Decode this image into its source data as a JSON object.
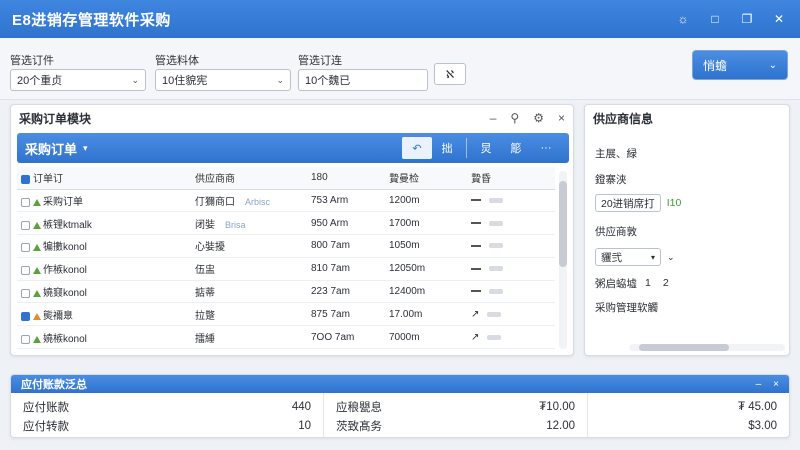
{
  "window": {
    "title": "E8进销存管理软件采购"
  },
  "filters": {
    "order": {
      "label": "管选订件",
      "value": "20个重贞"
    },
    "material": {
      "label": "管选料体",
      "value": "10住貌宪"
    },
    "orderno": {
      "label": "管选订连",
      "value": "10个魏已"
    },
    "clear_label": "ℵ",
    "top_dropdown": "悄蟾"
  },
  "orders_panel": {
    "title": "采购订单模块",
    "band_title": "采购订单",
    "band_icons": [
      "↶",
      "拙",
      "炅",
      "簓",
      "···"
    ],
    "columns": [
      "订单订",
      "供应商商",
      "180",
      "贄曼检",
      "贄昏"
    ],
    "rows": [
      {
        "name": "采购订单",
        "supplier": "仃獮商口",
        "supplier_extra": "Arbisc",
        "qty": "753 Arm",
        "amount": "1200m",
        "status": "dash",
        "checked": false,
        "icon": "green"
      },
      {
        "name": "槉锂ktmalk",
        "supplier": "闭娤",
        "supplier_extra": "Brisa",
        "qty": "950 Arm",
        "amount": "1700m",
        "status": "dash",
        "checked": false,
        "icon": "green"
      },
      {
        "name": "犏擻konol",
        "supplier": "心娤擾",
        "supplier_extra": "",
        "qty": "800 7am",
        "amount": "1050m",
        "status": "dash",
        "checked": false,
        "icon": "green"
      },
      {
        "name": "作槉konol",
        "supplier": "伍盅",
        "supplier_extra": "",
        "qty": "810 7am",
        "amount": "12050m",
        "status": "dash",
        "checked": false,
        "icon": "green"
      },
      {
        "name": "嬈窡konol",
        "supplier": "掂蒂",
        "supplier_extra": "",
        "qty": "223 7am",
        "amount": "12400m",
        "status": "dash",
        "checked": false,
        "icon": "green"
      },
      {
        "name": "熋襧臮",
        "supplier": "拉蹩",
        "supplier_extra": "",
        "qty": "875 7am",
        "amount": "17.00m",
        "status": "up",
        "checked": true,
        "icon": "orange"
      },
      {
        "name": "嬈槉konol",
        "supplier": "擂綞",
        "supplier_extra": "",
        "qty": "7OO 7am",
        "amount": "7000m",
        "status": "up",
        "checked": false,
        "icon": "green"
      }
    ]
  },
  "supplier_panel": {
    "title": "供应商信息",
    "line1": "主展、緑",
    "line2": "鐙寨浃",
    "box_value": "20进销席打",
    "box_extra": "I10",
    "line3": "供应商敦",
    "select_value": "貜弐",
    "line4a": "粥启蛠墟",
    "line4b": "1",
    "line4c": "2",
    "line5": "采购管理软觸"
  },
  "summary_panel": {
    "title": "应付账款泛总",
    "col1": [
      {
        "label": "应付账款",
        "value": "440"
      },
      {
        "label": "应付转款",
        "value": "10"
      }
    ],
    "col2": [
      {
        "label": "应稂甖息",
        "value": "₮10.00"
      },
      {
        "label": "茨致髙务",
        "value": "12.00"
      }
    ],
    "col3": [
      {
        "value": "₮ 45.00"
      },
      {
        "value": "$3.00"
      }
    ]
  }
}
